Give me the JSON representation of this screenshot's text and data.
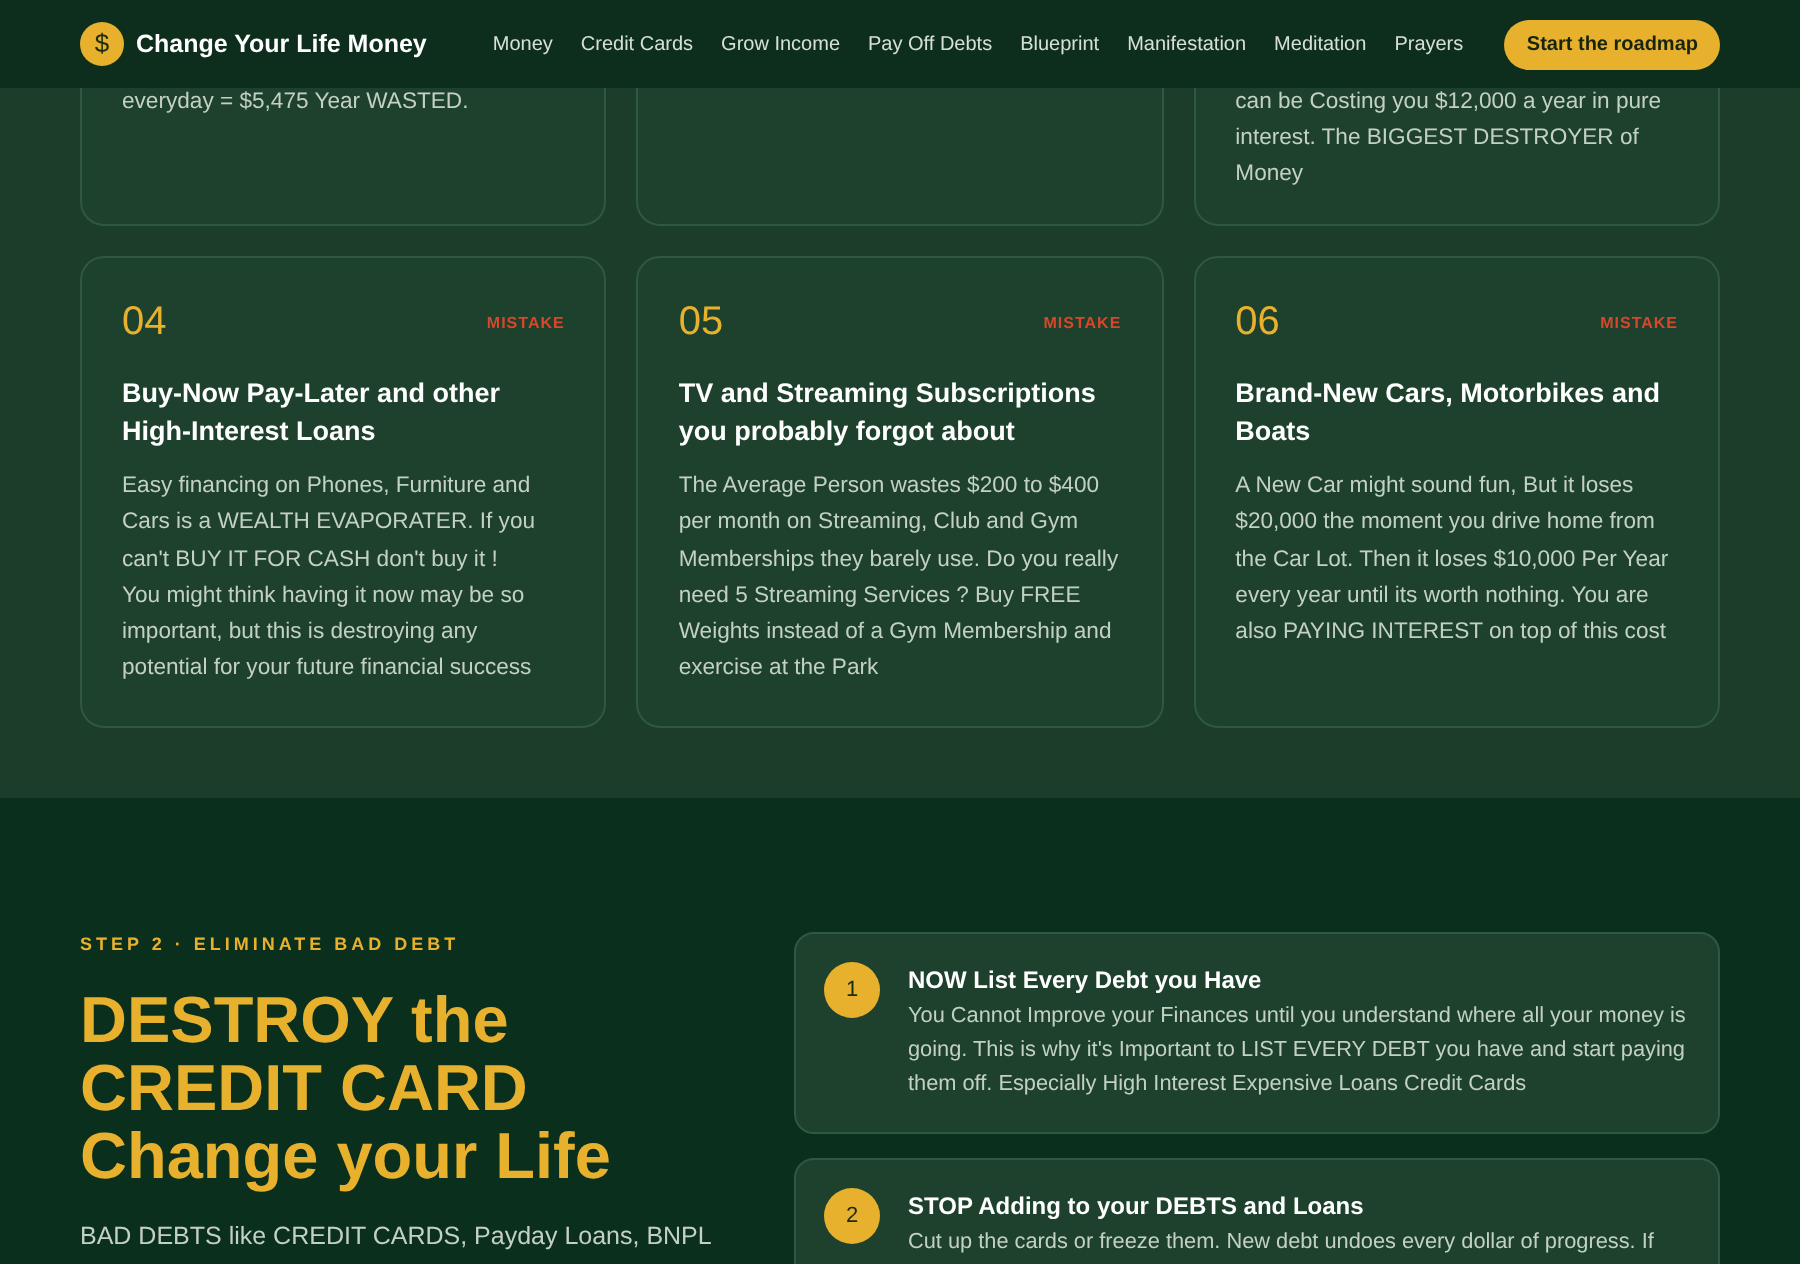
{
  "header": {
    "logo_symbol": "$",
    "brand": "Change Your Life Money",
    "nav": [
      "Money",
      "Credit Cards",
      "Grow Income",
      "Pay Off Debts",
      "Blueprint",
      "Manifestation",
      "Meditation",
      "Prayers"
    ],
    "cta": "Start the roadmap"
  },
  "top_cards": [
    {
      "kind": "text",
      "lines": [
        "everyday = $5,475 Year WASTED."
      ]
    },
    {
      "kind": "blank"
    },
    {
      "kind": "text",
      "lines": [
        "can be Costing you $12,000 a year in pure",
        "interest. The BIGGEST DESTROYER of",
        "Money"
      ]
    }
  ],
  "mistakes": [
    {
      "number": "04",
      "tag": "MISTAKE",
      "title": "Buy-Now Pay-Later and other High-Interest Loans",
      "body": [
        "Easy financing on Phones, Furniture and Cars is a WEALTH EVAPORATER. If you can't BUY IT FOR CASH don't buy it !",
        "You might think having it now may be so important, but this is destroying any potential for your future financial success"
      ]
    },
    {
      "number": "05",
      "tag": "MISTAKE",
      "title": "TV and Streaming Subscriptions you probably forgot about",
      "body": [
        "The Average Person wastes $200 to $400 per month on Streaming, Club and Gym Memberships they barely use. Do you really need 5 Streaming Services ? Buy FREE Weights instead of a Gym Membership and exercise at the Park"
      ]
    },
    {
      "number": "06",
      "tag": "MISTAKE",
      "title": "Brand-New Cars, Motorbikes and Boats",
      "body": [
        "A New Car might sound fun, But it loses $20,000 the moment you drive home from the Car Lot. Then it loses $10,000 Per Year every year until its worth nothing. You are also PAYING INTEREST on top of this cost"
      ]
    }
  ],
  "step": {
    "eyebrow": "STEP 2 · ELIMINATE BAD DEBT",
    "heading": [
      "DESTROY the",
      "CREDIT CARD",
      "Change your Life"
    ],
    "intro": "BAD DEBTS like CREDIT CARDS, Payday Loans, BNPL"
  },
  "steps": [
    {
      "number": "1",
      "title": "NOW List Every Debt you Have",
      "body": "You Cannot Improve your Finances until you understand where all your money is going. This is why it's Important to LIST EVERY DEBT you have and start paying them off. Especially High Interest Expensive Loans Credit Cards"
    },
    {
      "number": "2",
      "title": "STOP Adding to your DEBTS and Loans",
      "body": "Cut up the cards or freeze them. New debt undoes every dollar of progress. If"
    }
  ]
}
